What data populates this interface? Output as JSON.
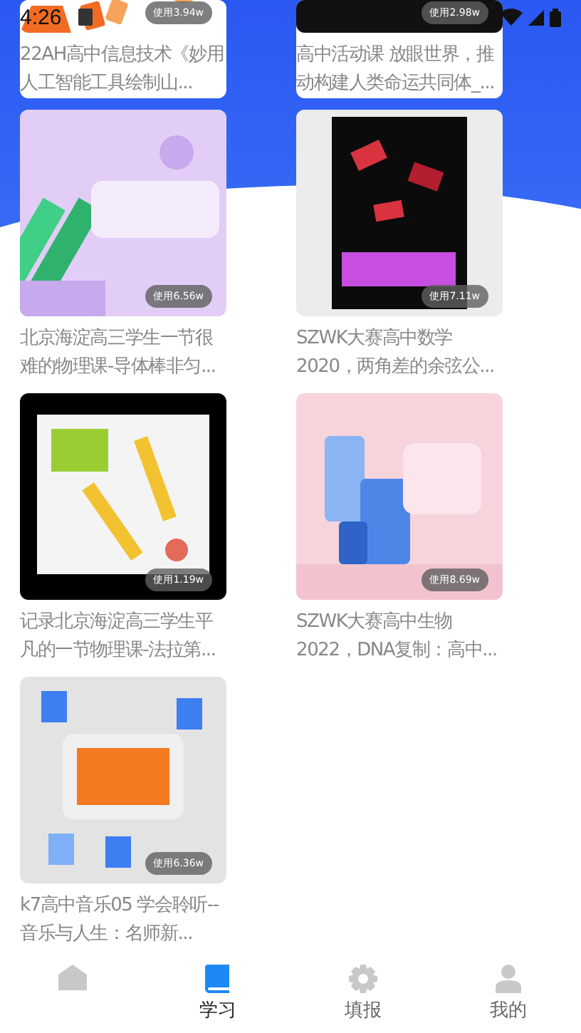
{
  "status_bar": {
    "time": "4:26"
  },
  "cards": [
    {
      "title": "22AH高中信息技术《妙用人工智能工具绘制山...",
      "usage": "使用3.94w"
    },
    {
      "title": "高中活动课 放眼世界，推动构建人类命运共同体_...",
      "usage": "使用2.98w"
    },
    {
      "title": "北京海淀高三学生一节很难的物理课-导体棒非匀...",
      "usage": "使用6.56w"
    },
    {
      "title": "SZWK大赛高中数学2020，两角差的余弦公...",
      "usage": "使用7.11w"
    },
    {
      "title": "记录北京海淀高三学生平凡的一节物理课-法拉第...",
      "usage": "使用1.19w"
    },
    {
      "title": "SZWK大赛高中生物2022，DNA复制：高中...",
      "usage": "使用8.69w"
    },
    {
      "title": "k7高中音乐05 学会聆听--音乐与人生：名师新...",
      "usage": "使用6.36w"
    }
  ],
  "tabs": [
    {
      "kind": "home",
      "selected": false
    },
    {
      "kind": "book",
      "label": "学习",
      "selected": true
    },
    {
      "kind": "gear",
      "label": "填报",
      "selected": false
    },
    {
      "kind": "person",
      "label": "我的",
      "selected": false
    }
  ]
}
